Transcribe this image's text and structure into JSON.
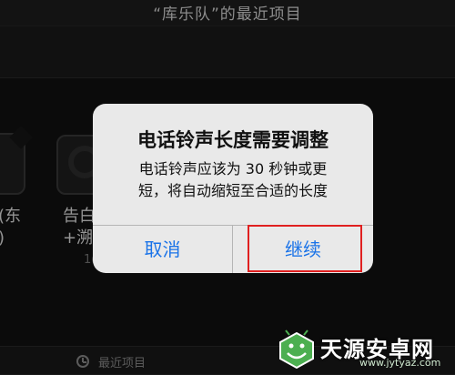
{
  "header": {
    "title": "“库乐队”的最近项目"
  },
  "songs": [
    {
      "name_line1": "(东",
      "name_line2": ")"
    },
    {
      "name_line1": "告白",
      "name_line2": "+溯",
      "meta": "1("
    }
  ],
  "bottom_bar": {
    "label": "最近项目",
    "icon": "clock-icon"
  },
  "alert": {
    "title": "电话铃声长度需要调整",
    "message_line1": "电话铃声应该为 30 秒钟或更",
    "message_line2": "短，将自动缩短至合适的长度",
    "cancel_label": "取消",
    "continue_label": "继续"
  },
  "colors": {
    "accent": "#1a73e8",
    "highlight": "#e02020",
    "dialog_bg": "#e9e9e9"
  },
  "watermark": {
    "name": "天源安卓网",
    "url": "www.jytyaz.com"
  }
}
